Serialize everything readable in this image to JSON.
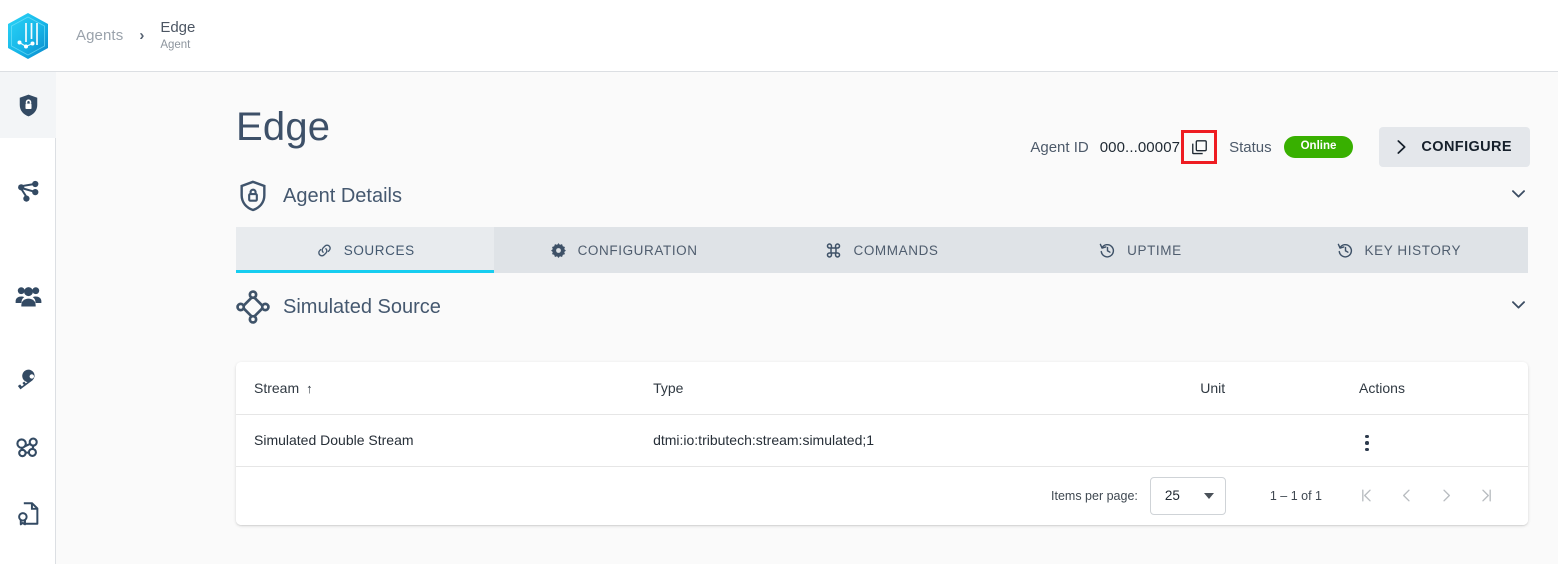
{
  "topbar": {
    "logo_name": "tributech-logo",
    "breadcrumb": {
      "root": "Agents",
      "separator": "›",
      "current_title": "Edge",
      "current_subtitle": "Agent"
    }
  },
  "sidebar": {
    "items": [
      {
        "name": "sidebar-item-agents",
        "icon": "shield-lock-icon",
        "active": true
      },
      {
        "name": "sidebar-item-twins",
        "icon": "share-network-icon",
        "active": false
      },
      {
        "name": "sidebar-item-users",
        "icon": "people-icon",
        "active": false
      },
      {
        "name": "sidebar-item-keys",
        "icon": "key-icon",
        "active": false
      },
      {
        "name": "sidebar-item-webhooks",
        "icon": "webhook-icon",
        "active": false
      },
      {
        "name": "sidebar-item-certificates",
        "icon": "certificate-document-icon",
        "active": false
      }
    ]
  },
  "page": {
    "title": "Edge",
    "agent_id_label": "Agent ID",
    "agent_id_value": "000...00007",
    "copy_icon": "copy-icon",
    "status_label": "Status",
    "status_value": "Online",
    "status_color": "#38b000",
    "configure_label": "CONFIGURE",
    "highlight_color": "#ee1c22"
  },
  "sections": [
    {
      "title": "Agent Details",
      "icon": "shield-lock-outline-icon",
      "expanded": true
    },
    {
      "title": "Simulated Source",
      "icon": "diamond-nodes-icon",
      "expanded": true
    }
  ],
  "tabs": [
    {
      "label": "SOURCES",
      "icon": "link-icon",
      "active": true
    },
    {
      "label": "CONFIGURATION",
      "icon": "gear-icon",
      "active": false
    },
    {
      "label": "COMMANDS",
      "icon": "command-icon",
      "active": false
    },
    {
      "label": "UPTIME",
      "icon": "history-icon",
      "active": false
    },
    {
      "label": "KEY HISTORY",
      "icon": "history-icon",
      "active": false
    }
  ],
  "table": {
    "columns": [
      "Stream",
      "Type",
      "Unit",
      "Actions"
    ],
    "sort_column": "Stream",
    "sort_arrow": "↑",
    "rows": [
      {
        "stream": "Simulated Double Stream",
        "type": "dtmi:io:tributech:stream:simulated;1",
        "unit": "",
        "actions_icon": "more-vertical-icon"
      }
    ]
  },
  "paginator": {
    "items_per_page_label": "Items per page:",
    "items_per_page_value": "25",
    "range_label": "1 – 1 of 1",
    "first_page_icon": "first-page-icon",
    "prev_page_icon": "prev-page-icon",
    "next_page_icon": "next-page-icon",
    "last_page_icon": "last-page-icon"
  },
  "theme": {
    "accent": "#17cdf0",
    "tab_bar_bg": "#dfe3e7",
    "main_bg": "#fafafa",
    "text_dark": "#38495e"
  }
}
